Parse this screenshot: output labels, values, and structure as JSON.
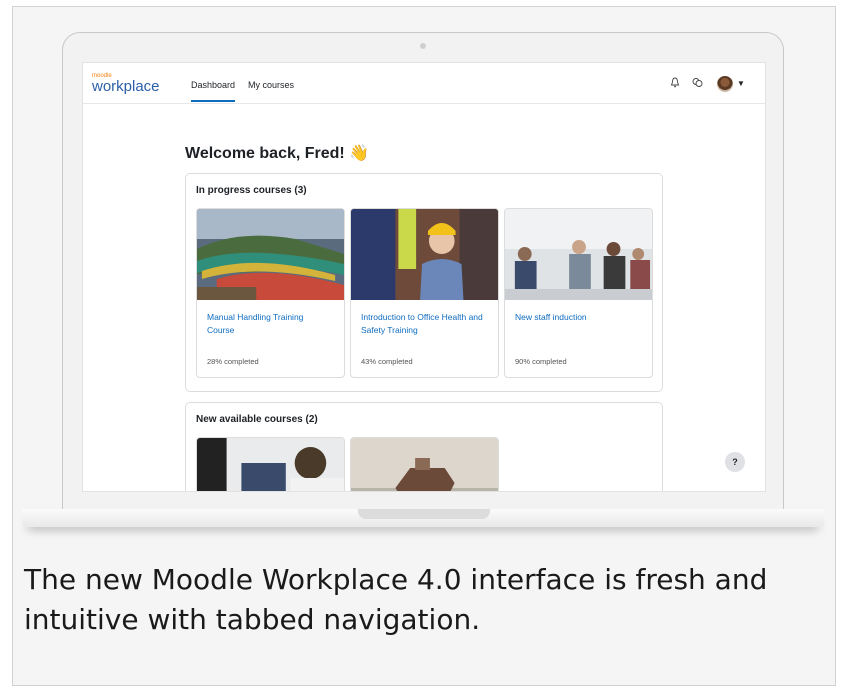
{
  "app": {
    "logo_top": "moodle",
    "logo_main": "workplace"
  },
  "nav": {
    "tabs": [
      {
        "label": "Dashboard",
        "active": true
      },
      {
        "label": "My courses",
        "active": false
      }
    ]
  },
  "dashboard": {
    "welcome": "Welcome back, Fred! 👋",
    "in_progress": {
      "title": "In progress courses (3)",
      "courses": [
        {
          "name": "Manual Handling Training Course",
          "progress": "28% completed"
        },
        {
          "name": "Introduction to Office Health and Safety Training",
          "progress": "43% completed"
        },
        {
          "name": "New staff induction",
          "progress": "90% completed"
        }
      ]
    },
    "new_available": {
      "title": "New available courses (2)"
    },
    "help_label": "?"
  },
  "icons": [
    "bell-icon",
    "chat-icon",
    "caret-down-icon",
    "help-icon"
  ],
  "colors": {
    "link": "#0f6cbf",
    "brand_orange": "#f98012",
    "brand_blue": "#2b5fa8"
  },
  "caption": "The new Moodle Workplace 4.0 interface is fresh and intuitive with tabbed navigation."
}
